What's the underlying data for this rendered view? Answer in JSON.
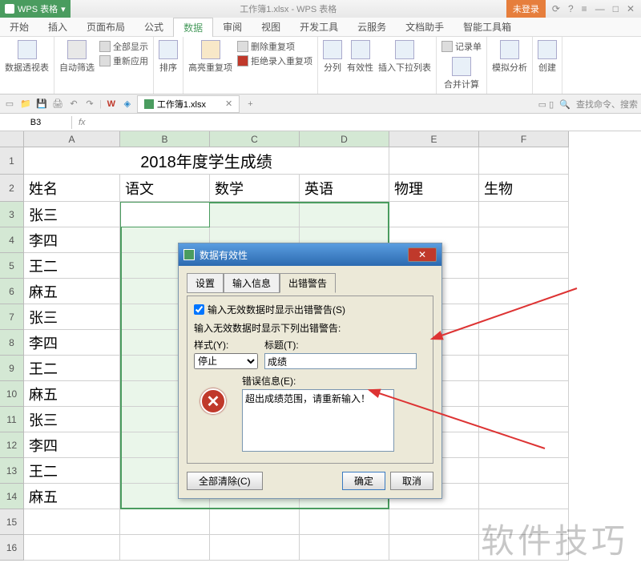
{
  "titlebar": {
    "app_name": "WPS 表格",
    "doc_title": "工作簿1.xlsx - WPS 表格",
    "login": "未登录"
  },
  "menu": {
    "items": [
      "开始",
      "插入",
      "页面布局",
      "公式",
      "数据",
      "审阅",
      "视图",
      "开发工具",
      "云服务",
      "文档助手",
      "智能工具箱"
    ],
    "active_index": 4
  },
  "ribbon": {
    "pivot": "数据透视表",
    "autofilter": "自动筛选",
    "show_all": "全部显示",
    "reapply": "重新应用",
    "sort": "排序",
    "highlight_dup": "高亮重复项",
    "delete_dup": "删除重复项",
    "reject_dup": "拒绝录入重复项",
    "text_to_col": "分列",
    "validity": "有效性",
    "insert_dropdown": "插入下拉列表",
    "record_form": "记录单",
    "consolidate": "合并计算",
    "what_if": "模拟分析",
    "create_group": "创建"
  },
  "qat": {
    "doc_tab": "工作簿1.xlsx",
    "search_placeholder": "查找命令、搜索"
  },
  "formula": {
    "namebox": "B3",
    "fx": "fx"
  },
  "grid": {
    "cols": [
      "A",
      "B",
      "C",
      "D",
      "E",
      "F"
    ],
    "title_merged": "2018年度学生成绩",
    "headers": [
      "姓名",
      "语文",
      "数学",
      "英语",
      "物理",
      "生物"
    ],
    "names": [
      "张三",
      "李四",
      "王二",
      "麻五",
      "张三",
      "李四",
      "王二",
      "麻五",
      "张三",
      "李四",
      "王二",
      "麻五"
    ]
  },
  "dialog": {
    "title": "数据有效性",
    "tabs": [
      "设置",
      "输入信息",
      "出错警告"
    ],
    "check_label": "输入无效数据时显示出错警告(S)",
    "fieldset": "输入无效数据时显示下列出错警告:",
    "style_label": "样式(Y):",
    "style_value": "停止",
    "title_label": "标题(T):",
    "title_value": "成绩",
    "msg_label": "错误信息(E):",
    "msg_value": "超出成绩范围，请重新输入！",
    "clear": "全部清除(C)",
    "ok": "确定",
    "cancel": "取消"
  },
  "watermark": "软件技巧"
}
